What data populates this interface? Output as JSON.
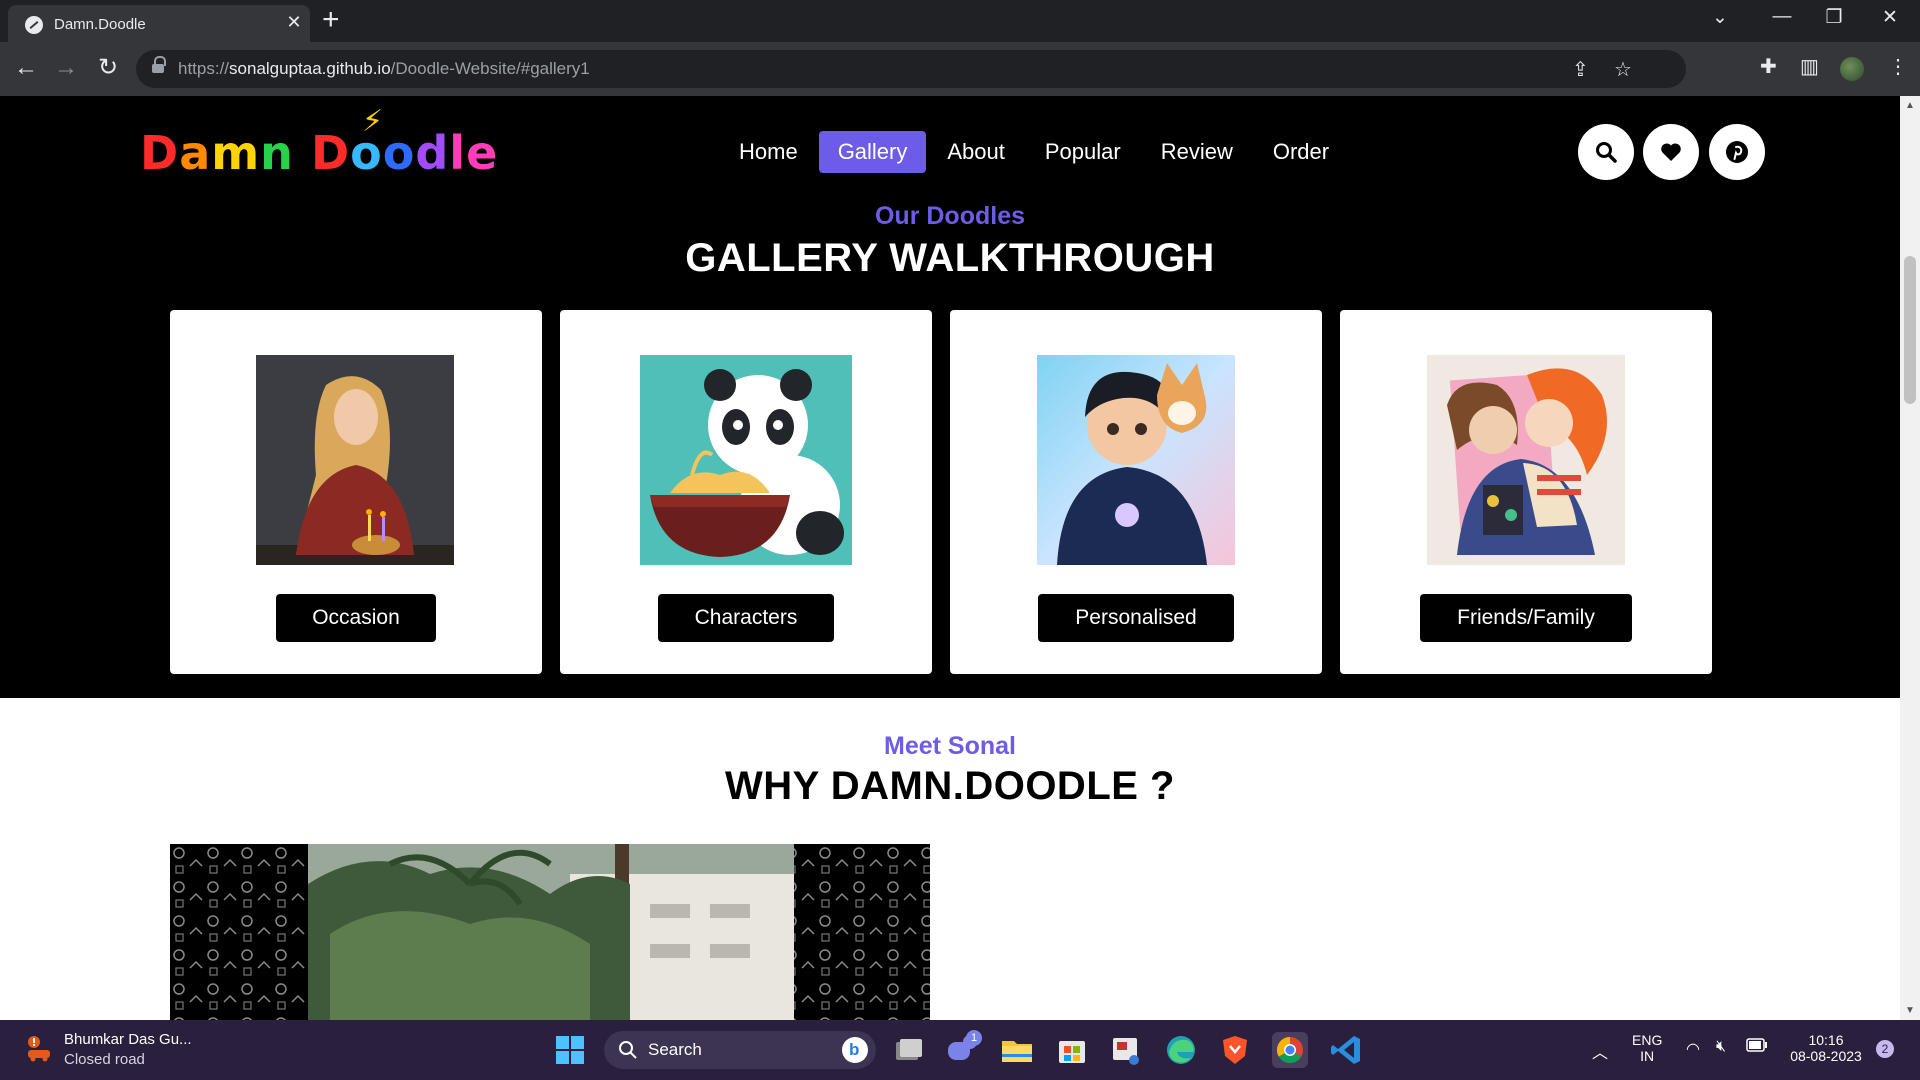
{
  "browser": {
    "tab_title": "Damn.Doodle",
    "url_scheme": "https://",
    "url_host": "sonalguptaa.github.io",
    "url_path": "/Doodle-Website/#gallery1"
  },
  "site": {
    "logo_text": "Damn Doodle",
    "nav": [
      {
        "label": "Home",
        "active": false
      },
      {
        "label": "Gallery",
        "active": true
      },
      {
        "label": "About",
        "active": false
      },
      {
        "label": "Popular",
        "active": false
      },
      {
        "label": "Review",
        "active": false
      },
      {
        "label": "Order",
        "active": false
      }
    ],
    "header_icons": [
      "search-icon",
      "heart-icon",
      "pinterest-icon"
    ],
    "accent_color": "#6c5ce7"
  },
  "gallery": {
    "subtitle": "Our Doodles",
    "title": "GALLERY WALKTHROUGH",
    "cards": [
      {
        "label": "Occasion"
      },
      {
        "label": "Characters"
      },
      {
        "label": "Personalised"
      },
      {
        "label": "Friends/Family"
      }
    ]
  },
  "about": {
    "subtitle": "Meet Sonal",
    "title": "WHY DAMN.DOODLE ?"
  },
  "taskbar": {
    "weather_title": "Bhumkar Das Gu...",
    "weather_sub": "Closed road",
    "search_label": "Search",
    "teams_badge": "1",
    "lang_1": "ENG",
    "lang_2": "IN",
    "time": "10:16",
    "date": "08-08-2023",
    "notification_count": "2"
  }
}
